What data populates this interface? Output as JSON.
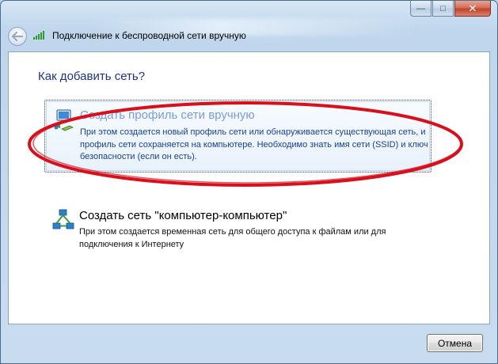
{
  "window": {
    "title": "Подключение к беспроводной сети вручную",
    "controls": {
      "minimize": "—",
      "maximize": "□",
      "close": "✕"
    }
  },
  "icons": {
    "back": "back-arrow-icon",
    "title": "wireless-signal-icon",
    "option1": "network-profile-icon",
    "option2": "ad-hoc-network-icon"
  },
  "content": {
    "heading": "Как добавить сеть?",
    "options": [
      {
        "title": "Создать профиль сети вручную",
        "description": "При этом создается новый профиль сети или обнаруживается существующая сеть, и профиль сети сохраняется на компьютере. Необходимо знать имя сети (SSID) и ключ безопасности (если он есть)."
      },
      {
        "title": "Создать сеть \"компьютер-компьютер\"",
        "description": "При этом создается временная сеть для общего доступа к файлам или для подключения к Интернету"
      }
    ]
  },
  "footer": {
    "cancel_label": "Отмена"
  },
  "colors": {
    "heading": "#1e3287",
    "option_selected_title": "#7b9cd9",
    "option_description": "#1e3d8f",
    "annotation_ellipse": "#d9101b"
  }
}
